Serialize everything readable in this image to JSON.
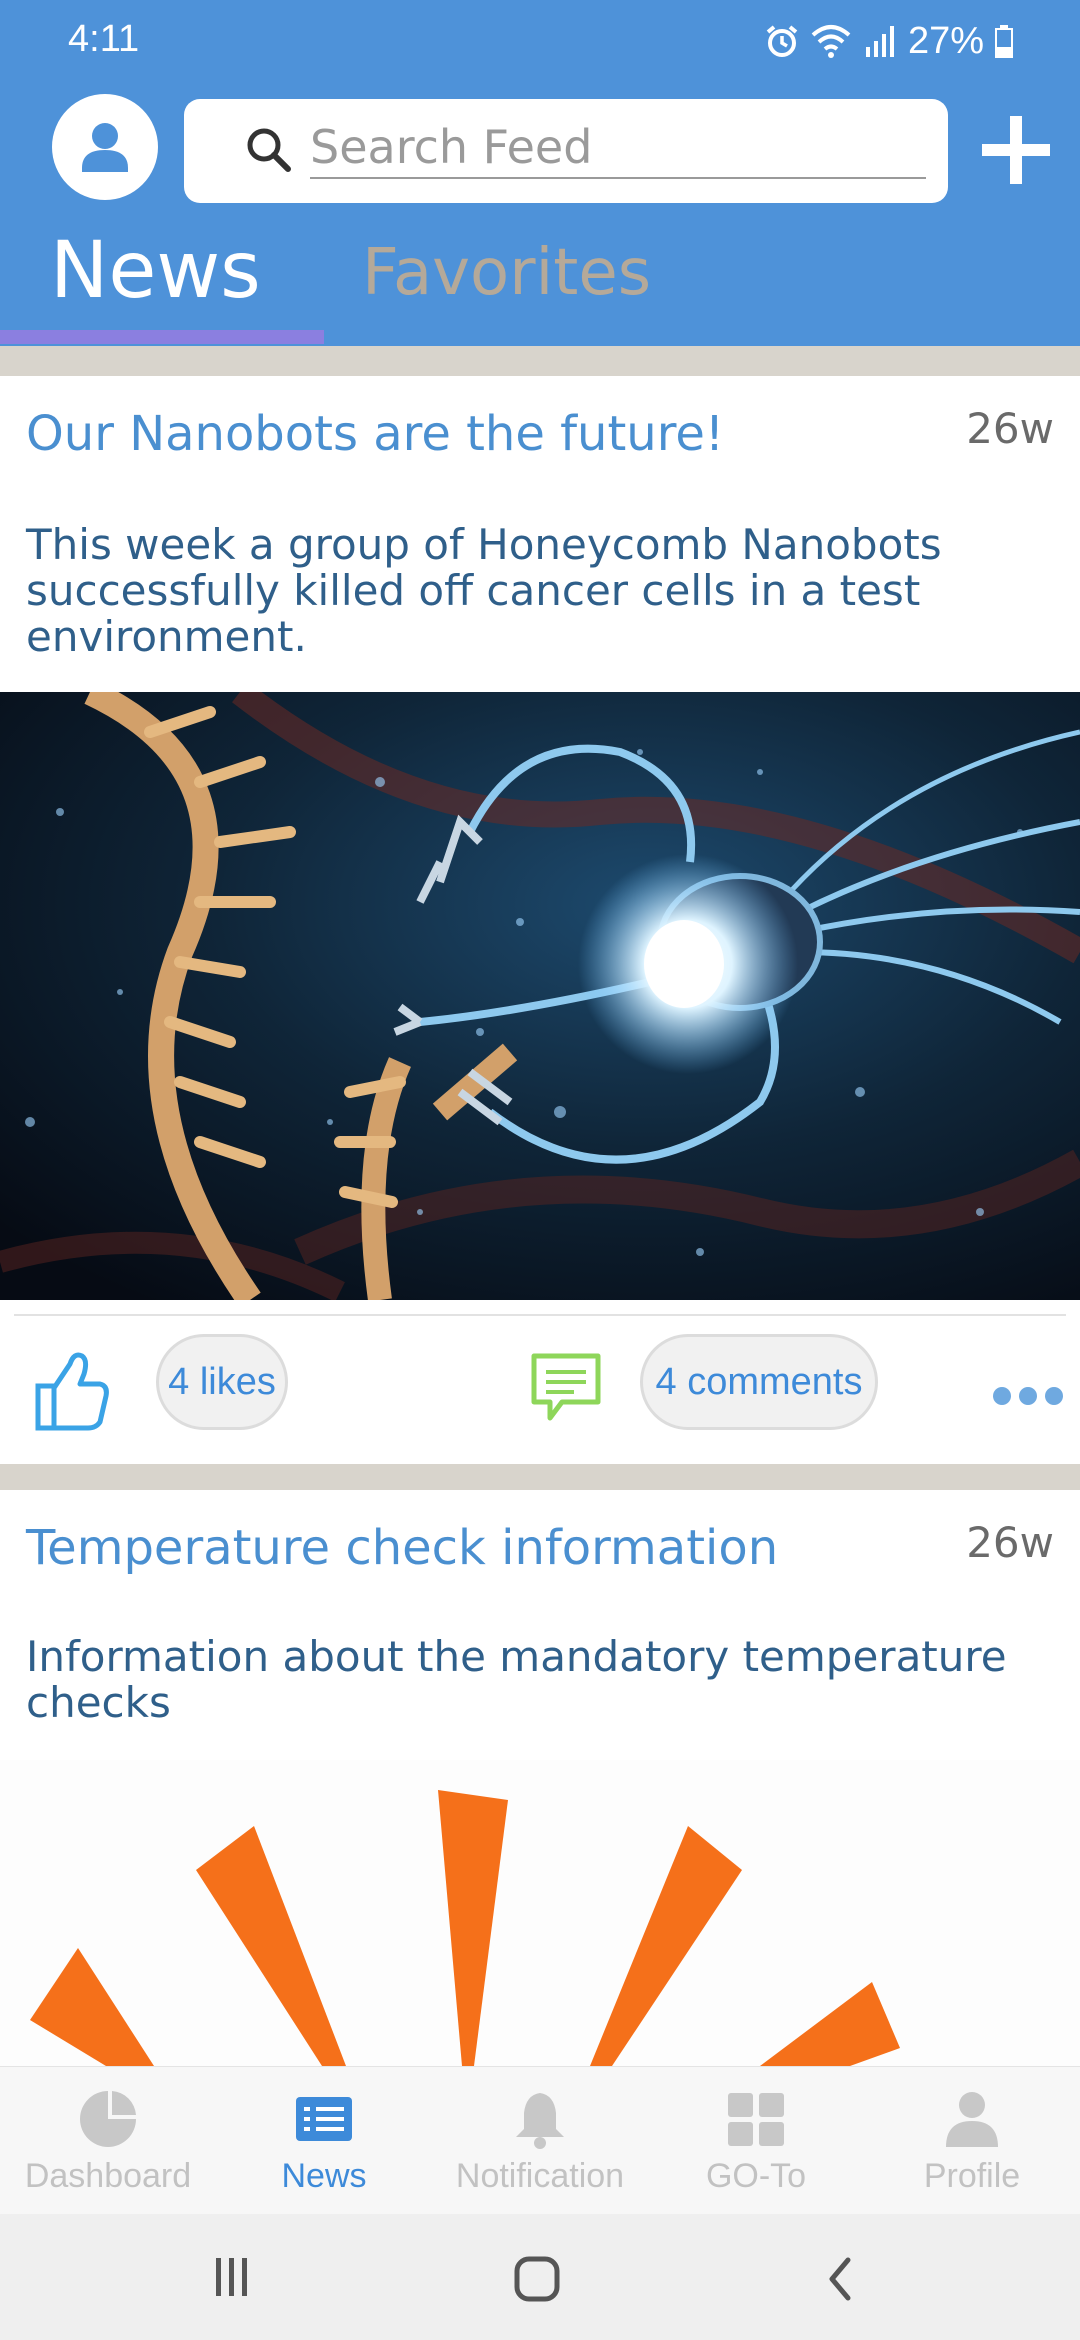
{
  "status_bar": {
    "time": "4:11",
    "battery": "27%"
  },
  "header": {
    "search_placeholder": "Search Feed",
    "tabs": [
      {
        "label": "News",
        "active": true
      },
      {
        "label": "Favorites",
        "active": false
      }
    ]
  },
  "posts": [
    {
      "title": "Our Nanobots are the future!",
      "age": "26w",
      "body": "This week a group of Honeycomb Nanobots successfully killed off cancer cells in a test environment.",
      "likes_label": "4 likes",
      "comments_label": "4 comments"
    },
    {
      "title": "Temperature check information",
      "age": "26w",
      "body": "Information about the mandatory temperature checks"
    }
  ],
  "bottom_nav": {
    "items": [
      {
        "label": "Dashboard",
        "icon": "pie-chart-icon",
        "active": false
      },
      {
        "label": "News",
        "icon": "news-list-icon",
        "active": true
      },
      {
        "label": "Notification",
        "icon": "bell-icon",
        "active": false
      },
      {
        "label": "GO-To",
        "icon": "grid-icon",
        "active": false
      },
      {
        "label": "Profile",
        "icon": "user-icon",
        "active": false
      }
    ]
  },
  "colors": {
    "header_bg": "#4e92d9",
    "tab_indicator": "#8b7fe0",
    "title_blue": "#4a8fd0",
    "body_blue": "#2f5f8a",
    "accent_orange": "#f5701a",
    "comment_green": "#8ed65a"
  }
}
